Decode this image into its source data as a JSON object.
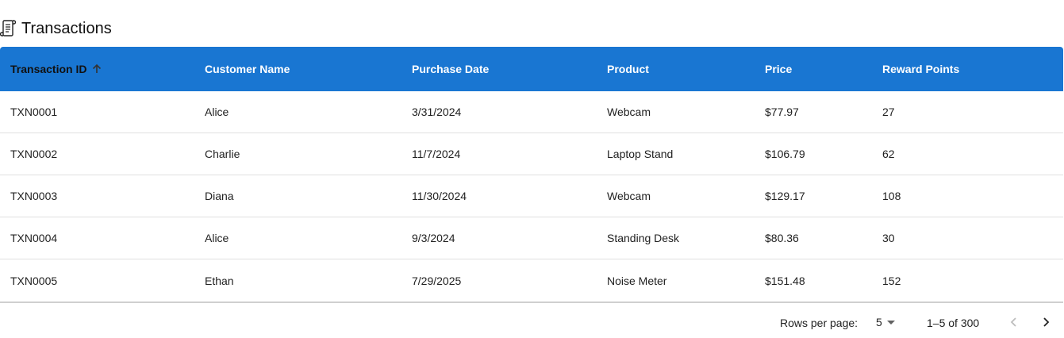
{
  "title": "Transactions",
  "columns": [
    "Transaction ID",
    "Customer Name",
    "Purchase Date",
    "Product",
    "Price",
    "Reward Points"
  ],
  "sorted_column": "Transaction ID",
  "sort_direction": "ascending",
  "rows": [
    [
      "TXN0001",
      "Alice",
      "3/31/2024",
      "Webcam",
      "$77.97",
      "27"
    ],
    [
      "TXN0002",
      "Charlie",
      "11/7/2024",
      "Laptop Stand",
      "$106.79",
      "62"
    ],
    [
      "TXN0003",
      "Diana",
      "11/30/2024",
      "Webcam",
      "$129.17",
      "108"
    ],
    [
      "TXN0004",
      "Alice",
      "9/3/2024",
      "Standing Desk",
      "$80.36",
      "30"
    ],
    [
      "TXN0005",
      "Ethan",
      "7/29/2025",
      "Noise Meter",
      "$151.48",
      "152"
    ]
  ],
  "pagination": {
    "rows_per_page_label": "Rows per page:",
    "rows_per_page": "5",
    "range": "1–5 of 300"
  },
  "colors": {
    "header_bg": "#1976d2",
    "header_text": "#ffffff",
    "row_divider": "#e0e0e0"
  },
  "icons": {
    "title": "scroll-icon",
    "sort": "arrow-up-icon",
    "prev": "chevron-left-icon",
    "next": "chevron-right-icon",
    "dropdown": "caret-down-icon"
  }
}
